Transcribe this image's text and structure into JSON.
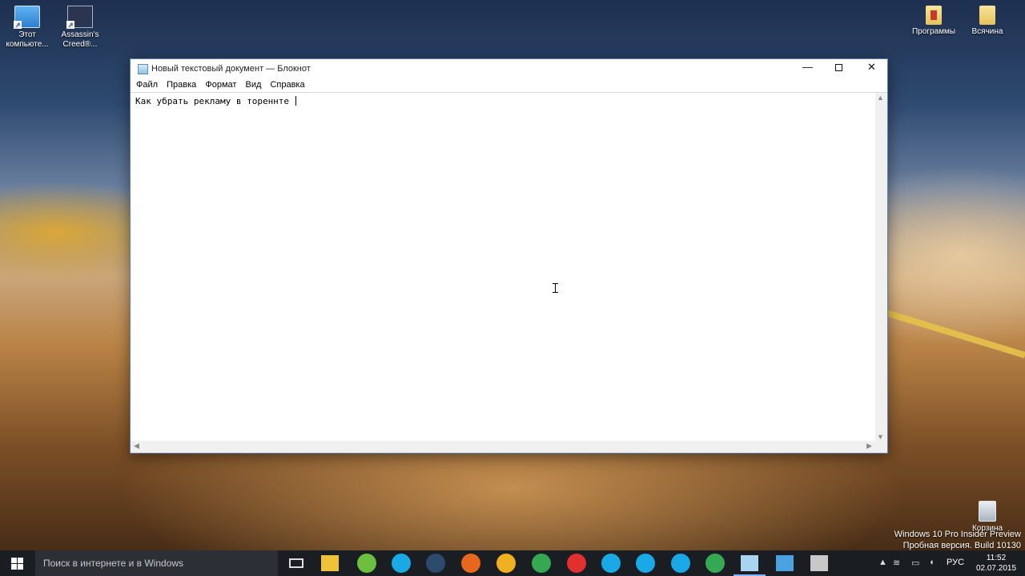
{
  "desktop": {
    "icons": [
      {
        "label": "Этот компьюте...",
        "icon": "this-pc-icon"
      },
      {
        "label": "Assassin's Creed®...",
        "icon": "assassins-creed-icon"
      },
      {
        "label": "Программы",
        "icon": "folder-icon"
      },
      {
        "label": "Всячина",
        "icon": "folder-icon"
      },
      {
        "label": "Корзина",
        "icon": "recycle-bin-icon"
      }
    ],
    "watermark": {
      "line1": "Windows 10 Pro Insider Preview",
      "line2": "Пробная версия. Build 10130"
    }
  },
  "notepad": {
    "title": "Новый текстовый документ — Блокнот",
    "menu": [
      "Файл",
      "Правка",
      "Формат",
      "Вид",
      "Справка"
    ],
    "content": "Как убрать рекламу в тореннте ",
    "controls": {
      "minimize": "—",
      "close": "✕"
    }
  },
  "taskbar": {
    "search_placeholder": "Поиск в интернете и в Windows",
    "pinned_apps": [
      {
        "name": "file-explorer",
        "color": "#f0c23a"
      },
      {
        "name": "utorrent",
        "color": "#6cbf3f"
      },
      {
        "name": "skype",
        "color": "#18a9e6"
      },
      {
        "name": "steam",
        "color": "#2c4a6a"
      },
      {
        "name": "firefox",
        "color": "#e8671e"
      },
      {
        "name": "pinwheel",
        "color": "#f0b020"
      },
      {
        "name": "chrome",
        "color": "#35a853"
      },
      {
        "name": "yandex",
        "color": "#e03030"
      },
      {
        "name": "skype",
        "color": "#18a9e6"
      },
      {
        "name": "skype",
        "color": "#18a9e6"
      },
      {
        "name": "skype",
        "color": "#18a9e6"
      },
      {
        "name": "chrome",
        "color": "#35a853"
      },
      {
        "name": "notepad",
        "color": "#a9d4ef"
      },
      {
        "name": "computer",
        "color": "#4aa3e0"
      },
      {
        "name": "device",
        "color": "#c8c8c8"
      }
    ],
    "language": "РУС",
    "time": "11:52",
    "date": "02.07.2015"
  }
}
